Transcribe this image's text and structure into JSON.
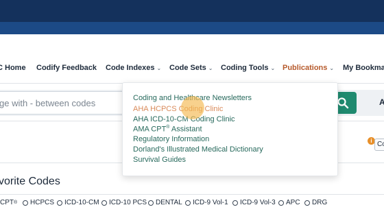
{
  "nav": {
    "items": [
      {
        "label": "C Home"
      },
      {
        "label": "Codify Feedback"
      },
      {
        "label": "Code Indexes",
        "caret": "⌄"
      },
      {
        "label": "Code Sets",
        "caret": "⌄"
      },
      {
        "label": "Coding Tools",
        "caret": "⌄"
      },
      {
        "label": "Publications",
        "caret": "⌄"
      },
      {
        "label": "My Bookma"
      }
    ]
  },
  "search": {
    "placeholder": "ge with - between codes",
    "right_text": "A"
  },
  "dropdown": {
    "items": [
      {
        "label": "Coding and Healthcare Newsletters"
      },
      {
        "label": "AHA HCPCS Coding Clinic"
      },
      {
        "label": "AHA ICD-10-CM Coding Clinic"
      },
      {
        "label": "AMA CPT",
        "sup": "®",
        "label_suffix": " Assistant"
      },
      {
        "label": "Regulatory Information"
      },
      {
        "label": "Dorland's Illustrated Medical Dictionary"
      },
      {
        "label": "Survival Guides"
      }
    ]
  },
  "info": {
    "icon_text": "i",
    "button_label": "Co"
  },
  "favorites": {
    "title": "vorite Codes",
    "options": [
      {
        "label": "CPT",
        "sup": "®"
      },
      {
        "label": "HCPCS"
      },
      {
        "label": "ICD-10-CM"
      },
      {
        "label": "ICD-10 PCS"
      },
      {
        "label": "DENTAL"
      },
      {
        "label": "ICD-9 Vol-1"
      },
      {
        "label": "ICD-9 Vol-3"
      },
      {
        "label": "APC"
      },
      {
        "label": "DRG"
      }
    ]
  },
  "colors": {
    "header_dark": "#14315c",
    "header_blue": "#1c4a86",
    "accent_green": "#1f8a6f",
    "publications_active": "#b65a2c",
    "menu_link": "#27695c"
  }
}
